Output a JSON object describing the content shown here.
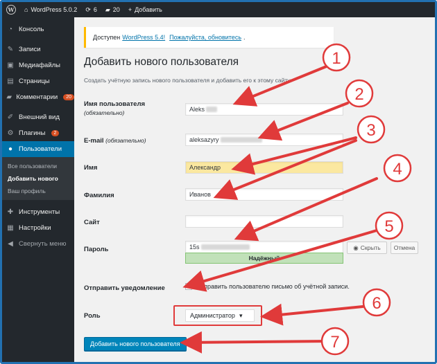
{
  "adminbar": {
    "site": "WordPress 5.0.2",
    "updates": "6",
    "comments": "20",
    "new": "Добавить"
  },
  "sidebar": {
    "items": [
      {
        "label": "Консоль",
        "icon": "dashboard-icon"
      },
      {
        "label": "Записи",
        "icon": "pin-icon"
      },
      {
        "label": "Медиафайлы",
        "icon": "media-icon"
      },
      {
        "label": "Страницы",
        "icon": "page-icon"
      },
      {
        "label": "Комментарии",
        "icon": "comment-icon",
        "badge": "20"
      },
      {
        "label": "Внешний вид",
        "icon": "brush-icon"
      },
      {
        "label": "Плагины",
        "icon": "plugin-icon",
        "badge": "2"
      },
      {
        "label": "Пользователи",
        "icon": "user-icon"
      },
      {
        "label": "Инструменты",
        "icon": "wrench-icon"
      },
      {
        "label": "Настройки",
        "icon": "settings-icon"
      },
      {
        "label": "Свернуть меню",
        "icon": "collapse-icon"
      }
    ],
    "submenu": [
      "Все пользователи",
      "Добавить нового",
      "Ваш профиль"
    ]
  },
  "notice": {
    "prefix": "Доступен",
    "link1": "WordPress 5.4!",
    "link2": "Пожалуйста, обновитесь",
    "suffix": "."
  },
  "page": {
    "title": "Добавить нового пользователя",
    "desc": "Создать учётную запись нового пользователя и добавить его к этому сайту."
  },
  "form": {
    "username_label": "Имя пользователя",
    "required": "(обязательно)",
    "username_value": "Aleks",
    "email_label": "E-mail",
    "email_value": "aleksazyry",
    "firstname_label": "Имя",
    "firstname_value": "Александр",
    "lastname_label": "Фамилия",
    "lastname_value": "Иванов",
    "site_label": "Сайт",
    "site_value": "",
    "password_label": "Пароль",
    "password_value": "15s",
    "hide_label": "Скрыть",
    "cancel_label": "Отмена",
    "strength": "Надёжный",
    "notify_label": "Отправить уведомление",
    "notify_text": "Отправить пользователю письмо об учётной записи.",
    "role_label": "Роль",
    "role_value": "Администратор",
    "submit": "Добавить нового пользователя"
  },
  "annotations": [
    "1",
    "2",
    "3",
    "4",
    "5",
    "6",
    "7"
  ],
  "colors": {
    "admin_dark": "#23282d",
    "accent": "#0073aa",
    "annotation_red": "#e03a3a",
    "strength_green": "#c1e1b9",
    "autofill_yellow": "#fbe8a0"
  }
}
